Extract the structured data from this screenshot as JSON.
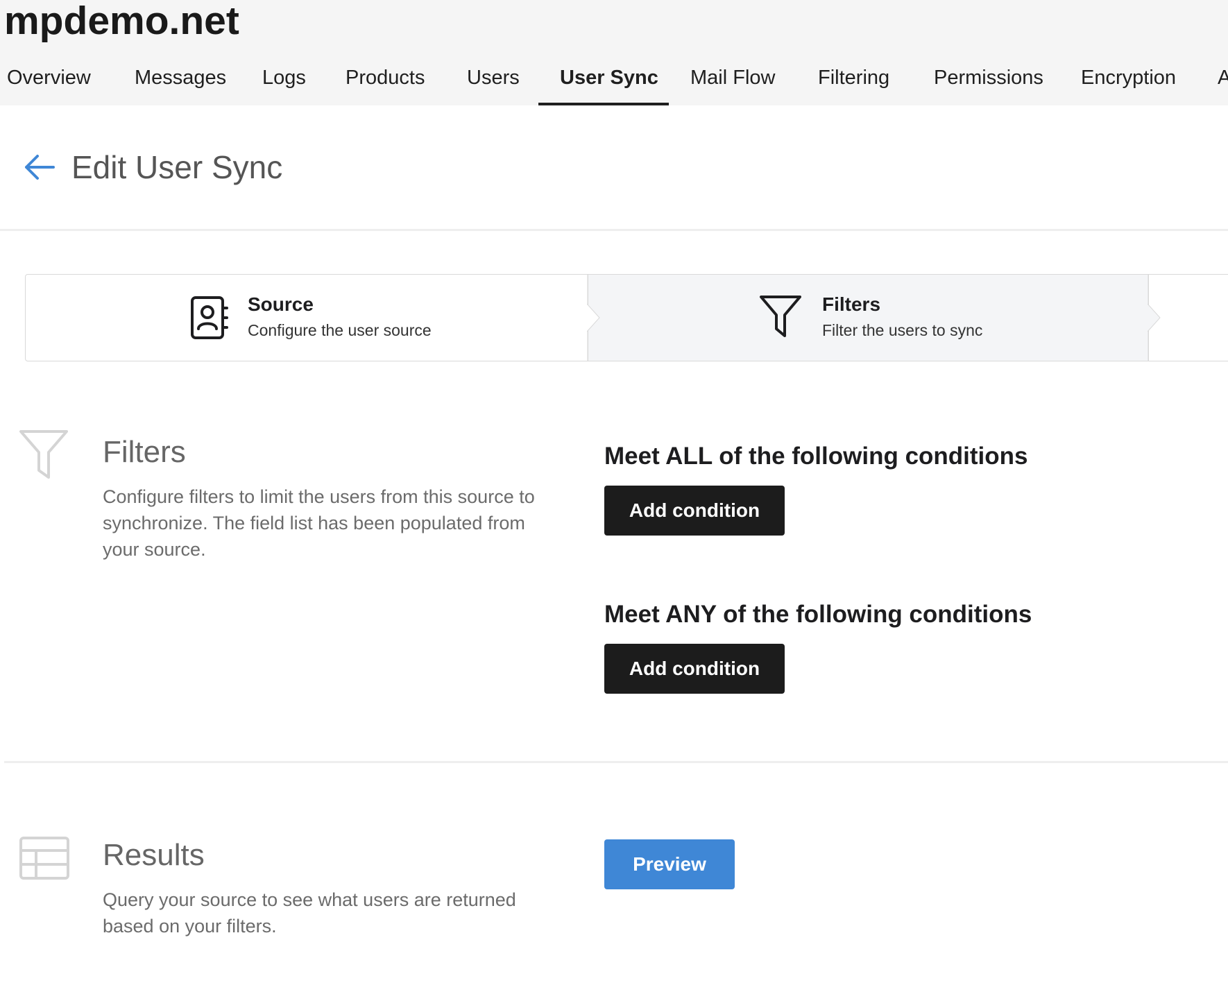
{
  "header": {
    "domain": "mpdemo.net",
    "tabs": [
      {
        "label": "Overview"
      },
      {
        "label": "Messages"
      },
      {
        "label": "Logs"
      },
      {
        "label": "Products"
      },
      {
        "label": "Users"
      },
      {
        "label": "User Sync",
        "active": true
      },
      {
        "label": "Mail Flow"
      },
      {
        "label": "Filtering"
      },
      {
        "label": "Permissions"
      },
      {
        "label": "Encryption"
      },
      {
        "label": "A"
      }
    ]
  },
  "page": {
    "title": "Edit User Sync",
    "back_icon": "arrow-left-icon"
  },
  "stepper": {
    "steps": [
      {
        "title": "Source",
        "subtitle": "Configure the user source",
        "icon": "contact-book-icon"
      },
      {
        "title": "Filters",
        "subtitle": "Filter the users to sync",
        "icon": "funnel-icon",
        "active": true
      }
    ]
  },
  "filters_section": {
    "heading": "Filters",
    "description": "Configure filters to limit the users from this source to synchronize. The field list has been populated from your source.",
    "icon": "funnel-icon",
    "all_heading": "Meet ALL of the following conditions",
    "any_heading": "Meet ANY of the following conditions",
    "add_condition_label": "Add condition"
  },
  "results_section": {
    "heading": "Results",
    "description": "Query your source to see what users are returned based on your filters.",
    "icon": "table-icon",
    "preview_label": "Preview"
  },
  "colors": {
    "accent": "#3f87d6",
    "dark_button": "#1c1c1c",
    "header_bg": "#f5f5f5",
    "active_step_bg": "#f4f5f7"
  }
}
